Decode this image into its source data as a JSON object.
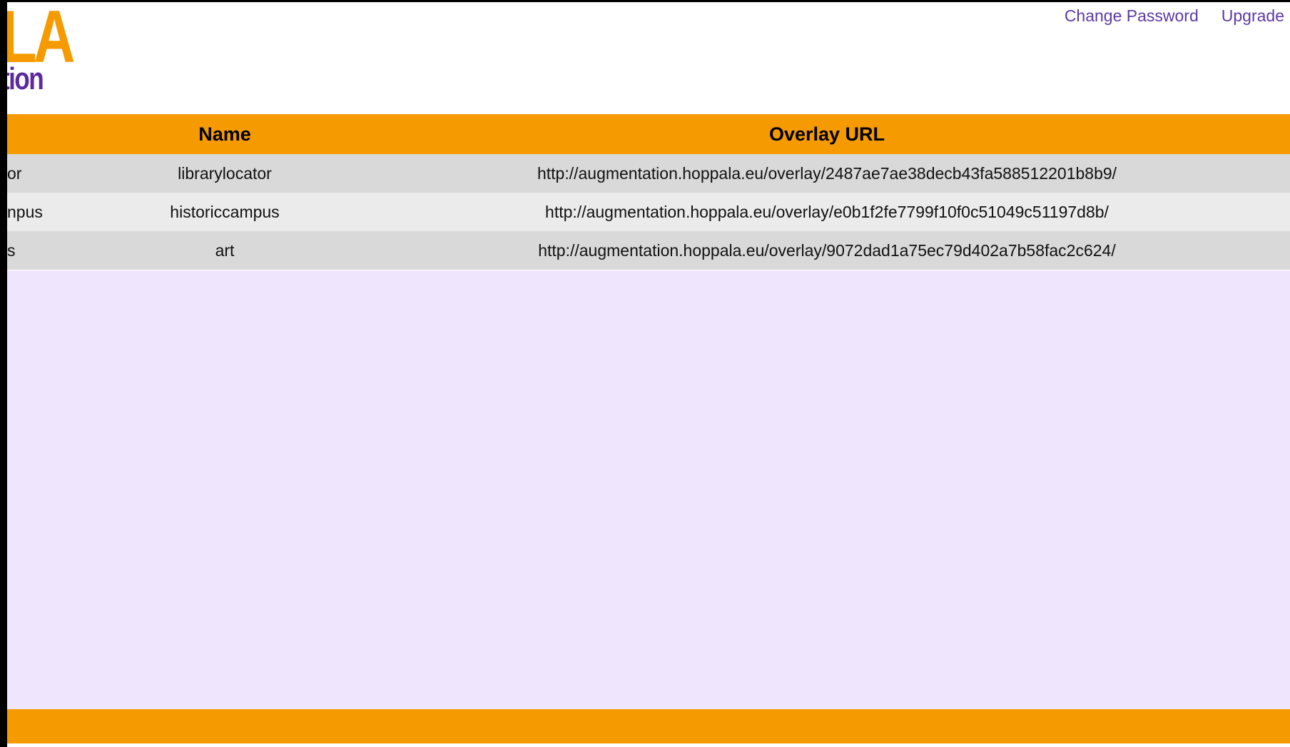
{
  "logo": {
    "top_text": "LA",
    "bottom_text": "tion"
  },
  "header_links": {
    "change_password": "Change Password",
    "upgrade": "Upgrade"
  },
  "table": {
    "columns": [
      "",
      "Name",
      "Overlay URL"
    ],
    "rows": [
      {
        "partial": "or",
        "name": "librarylocator",
        "url": "http://augmentation.hoppala.eu/overlay/2487ae7ae38decb43fa588512201b8b9/"
      },
      {
        "partial": "npus",
        "name": "historiccampus",
        "url": "http://augmentation.hoppala.eu/overlay/e0b1f2fe7799f10f0c51049c51197d8b/"
      },
      {
        "partial": "s",
        "name": "art",
        "url": "http://augmentation.hoppala.eu/overlay/9072dad1a75ec79d402a7b58fac2c624/"
      }
    ]
  },
  "colors": {
    "accent_orange": "#f59a00",
    "link_purple": "#5e3aa6",
    "logo_purple": "#5c2a9e",
    "content_background": "#efe6fd"
  }
}
